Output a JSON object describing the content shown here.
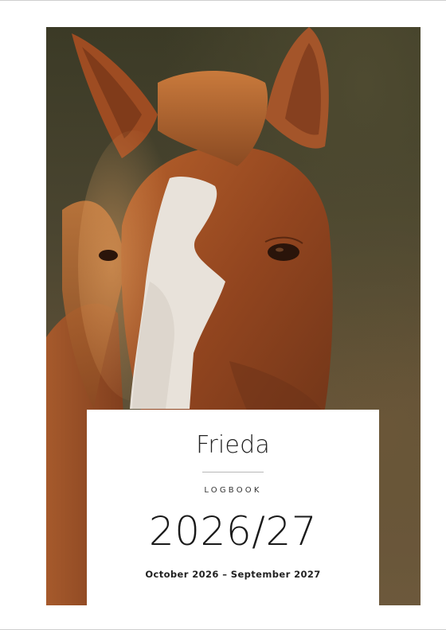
{
  "cover": {
    "photo_subject": "horse-head-photo",
    "name": "Frieda",
    "kicker": "LOGBOOK",
    "year": "2026/27",
    "date_range": "October 2026 – September 2027"
  },
  "colors": {
    "coat": "#9a4a22",
    "blaze": "#e8e2da",
    "background_dark": "#3b3a26",
    "card_background": "#ffffff",
    "text": "#1a1a1a"
  }
}
